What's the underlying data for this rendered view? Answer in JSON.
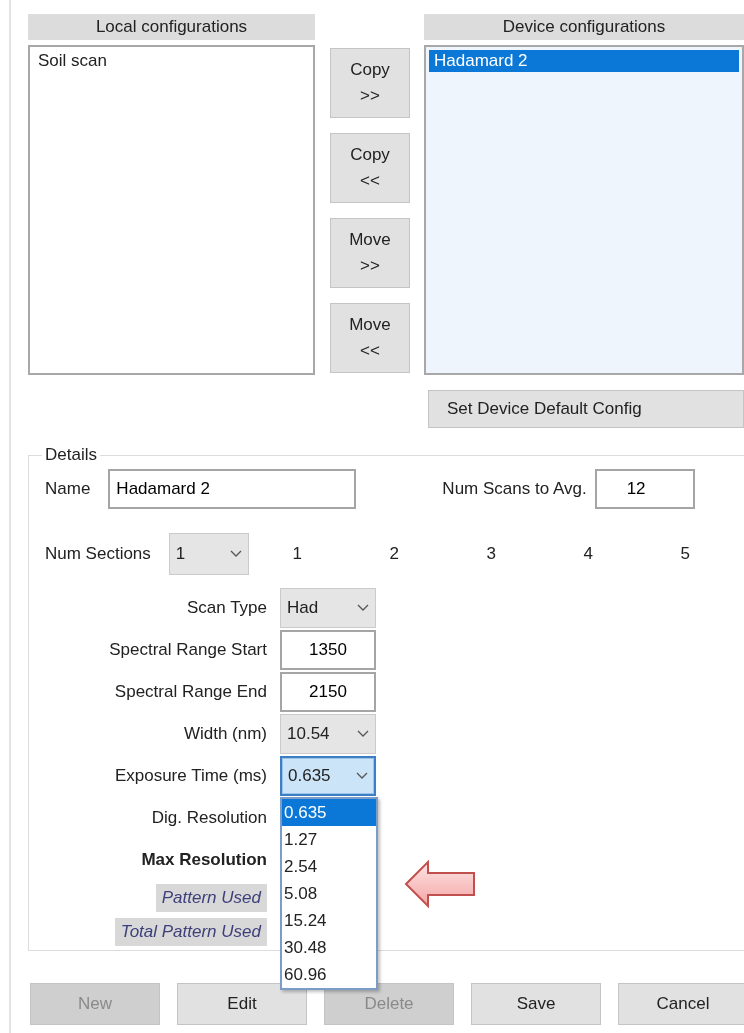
{
  "local_configurations": {
    "header": "Local configurations",
    "items": [
      {
        "label": "Soil scan",
        "selected": false
      }
    ]
  },
  "transfer_buttons": [
    {
      "lines": [
        "Copy",
        ">>"
      ]
    },
    {
      "lines": [
        "Copy",
        "<<"
      ]
    },
    {
      "lines": [
        "Move",
        ">>"
      ]
    },
    {
      "lines": [
        "Move",
        "<<"
      ]
    }
  ],
  "device_configurations": {
    "header": "Device configurations",
    "items": [
      {
        "label": "Hadamard 2",
        "selected": true
      }
    ]
  },
  "set_default_button": "Set Device Default Config",
  "details": {
    "legend": "Details",
    "name_label": "Name",
    "name_value": "Hadamard 2",
    "num_scans_label": "Num Scans to Avg.",
    "num_scans_value": "12",
    "num_sections_label": "Num Sections",
    "num_sections_value": "1",
    "section_columns": [
      "1",
      "2",
      "3",
      "4",
      "5"
    ],
    "fields": [
      {
        "label": "Scan Type",
        "kind": "dropdown",
        "value": "Had",
        "focused": false
      },
      {
        "label": "Spectral Range Start",
        "kind": "text",
        "value": "1350"
      },
      {
        "label": "Spectral Range End",
        "kind": "text",
        "value": "2150"
      },
      {
        "label": "Width (nm)",
        "kind": "dropdown",
        "value": "10.54",
        "focused": false
      },
      {
        "label": "Exposure Time (ms)",
        "kind": "dropdown",
        "value": "0.635",
        "focused": true,
        "expanded": true,
        "options": [
          {
            "label": "0.635",
            "selected": true
          },
          {
            "label": "1.27",
            "selected": false
          },
          {
            "label": "2.54",
            "selected": false
          },
          {
            "label": "5.08",
            "selected": false
          },
          {
            "label": "15.24",
            "selected": false
          },
          {
            "label": "30.48",
            "selected": false
          },
          {
            "label": "60.96",
            "selected": false
          }
        ]
      }
    ],
    "dig_resolution_label": "Dig. Resolution",
    "max_resolution_label": "Max Resolution",
    "pattern_used_label": "Pattern Used",
    "total_pattern_used_label": "Total Pattern Used"
  },
  "buttons": [
    {
      "label": "New",
      "disabled": true
    },
    {
      "label": "Edit",
      "disabled": false
    },
    {
      "label": "Delete",
      "disabled": true
    },
    {
      "label": "Save",
      "disabled": false
    },
    {
      "label": "Cancel",
      "disabled": false
    }
  ]
}
